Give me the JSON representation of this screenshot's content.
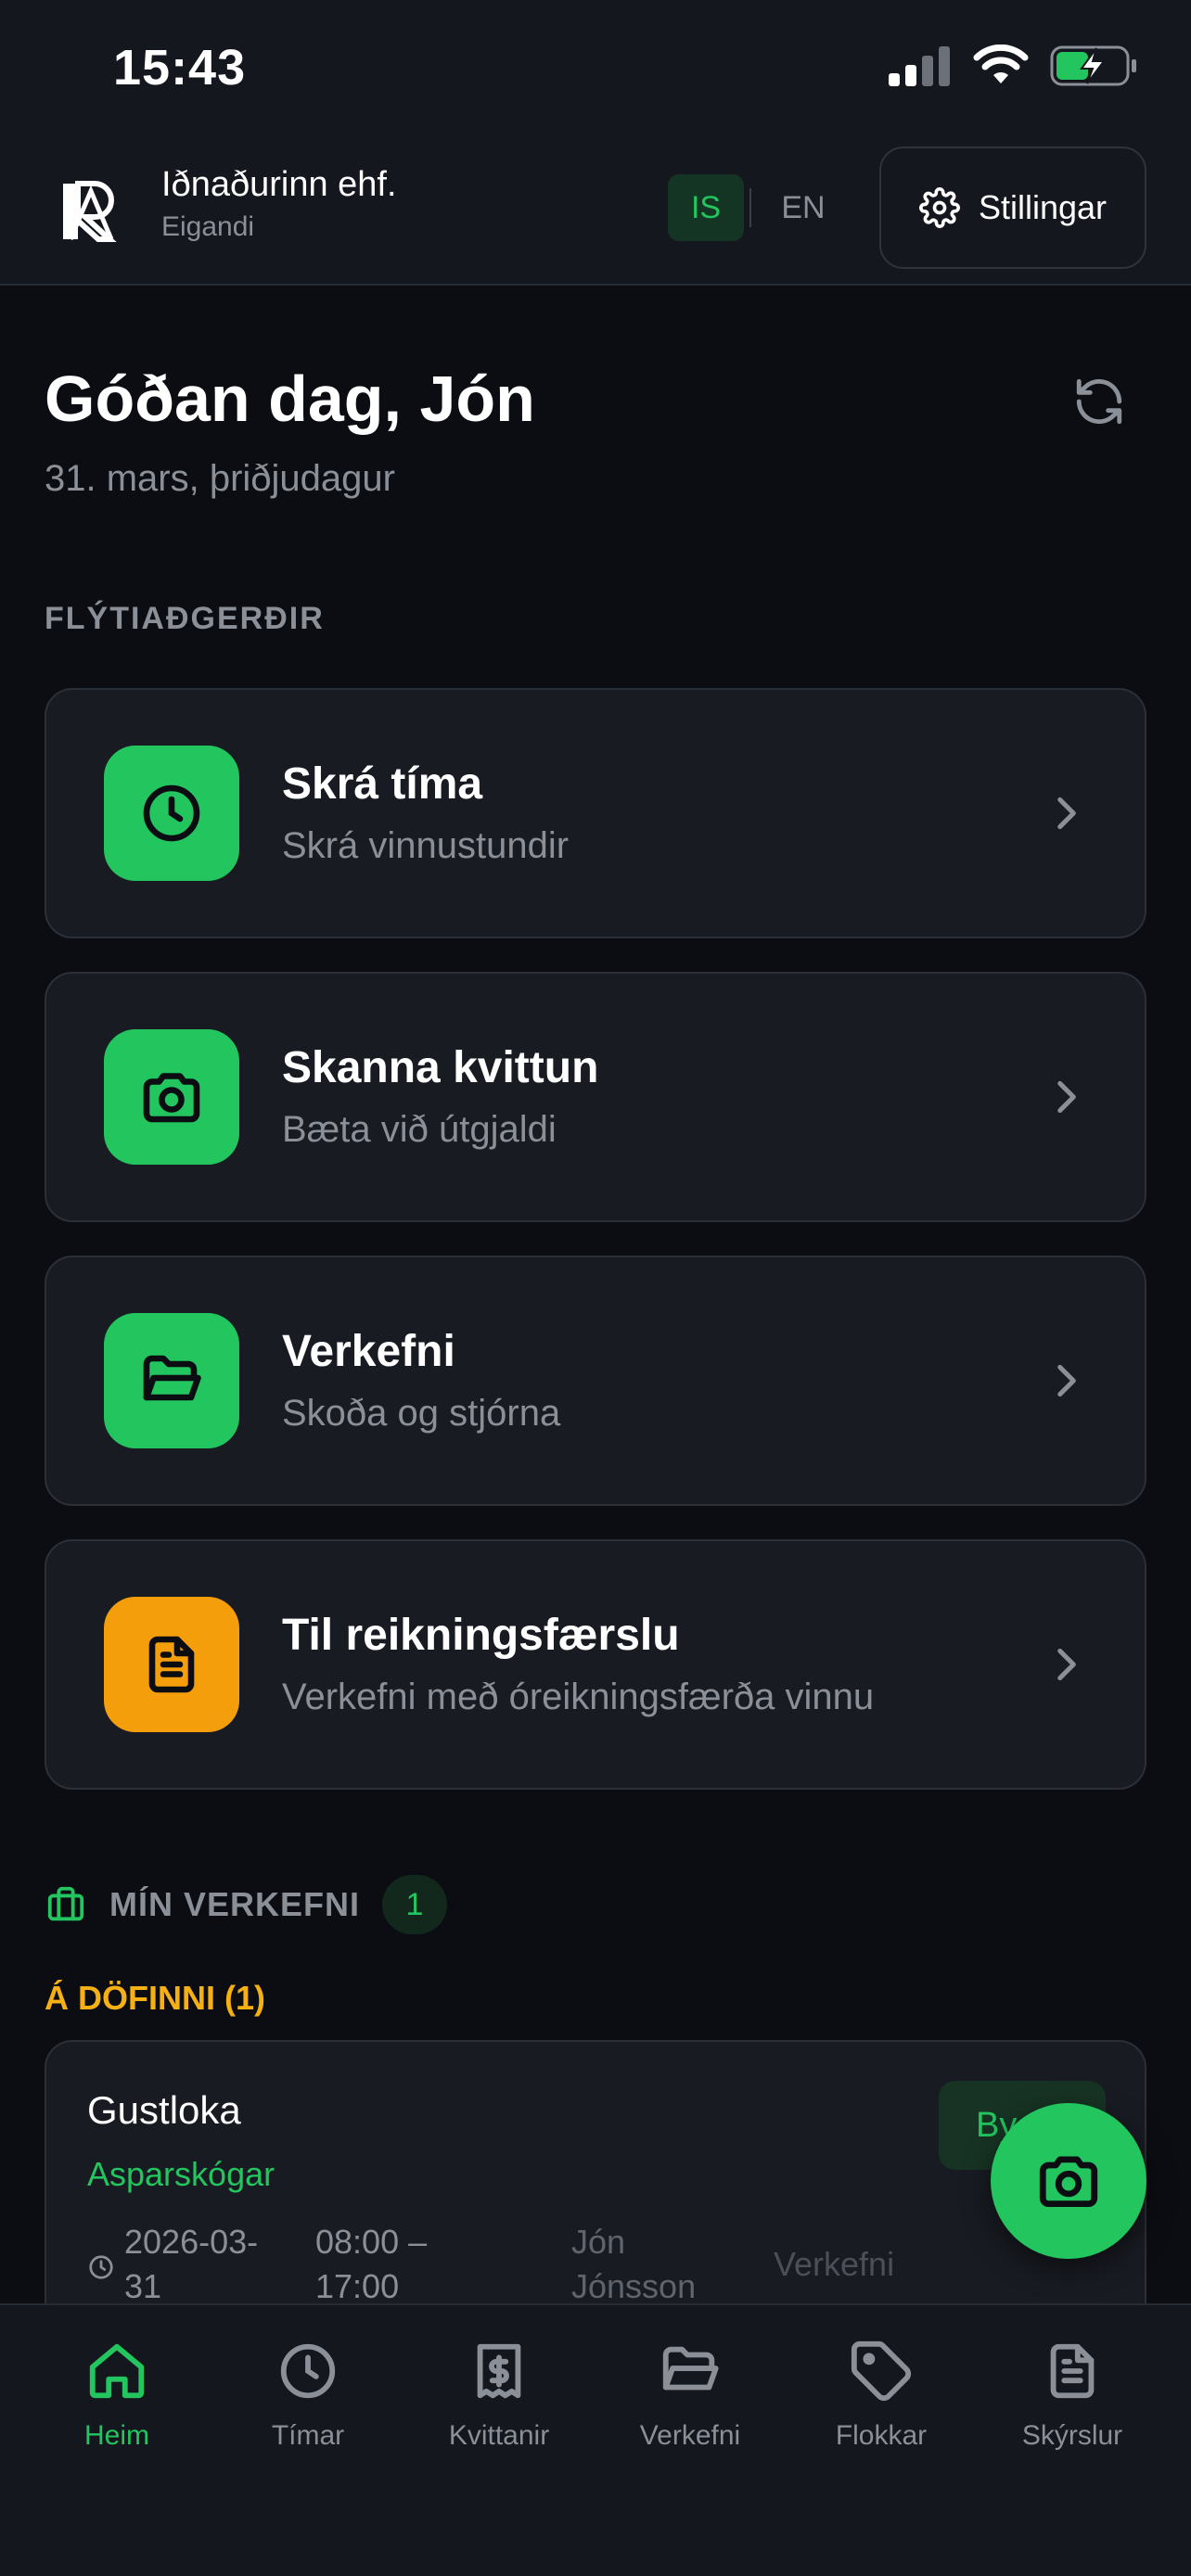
{
  "status_bar": {
    "time": "15:43"
  },
  "header": {
    "company_name": "Iðnaðurinn ehf.",
    "role": "Eigandi",
    "lang_is": "IS",
    "lang_en": "EN",
    "settings_label": "Stillingar"
  },
  "greeting": {
    "title": "Góðan dag, Jón",
    "date": "31. mars, þriðjudagur"
  },
  "quick_actions": {
    "label": "FLÝTIAÐGERÐIR",
    "items": [
      {
        "title": "Skrá tíma",
        "subtitle": "Skrá vinnustundir",
        "icon": "clock-icon",
        "color": "#22c55e"
      },
      {
        "title": "Skanna kvittun",
        "subtitle": "Bæta við útgjaldi",
        "icon": "camera-icon",
        "color": "#22c55e"
      },
      {
        "title": "Verkefni",
        "subtitle": "Skoða og stjórna",
        "icon": "folder-icon",
        "color": "#22c55e"
      },
      {
        "title": "Til reikningsfærslu",
        "subtitle": "Verkefni með óreikningsfærða vinnu",
        "icon": "document-icon",
        "color": "#f59e0b"
      }
    ]
  },
  "my_projects": {
    "label": "MÍN VERKEFNI",
    "count": "1",
    "pending_label": "Á DÖFINNI (1)",
    "task": {
      "title": "Gustloka",
      "subtitle": "Asparskógar",
      "status": "By",
      "date_line1": "2026-03-",
      "date_line2": "31",
      "time_line1": "08:00 –",
      "time_line2": "17:00",
      "person_line1": "Jón",
      "person_line2": "Jónsson",
      "type": "Verkefni"
    }
  },
  "tab_bar": {
    "items": [
      {
        "label": "Heim",
        "icon": "home-icon",
        "active": true
      },
      {
        "label": "Tímar",
        "icon": "clock-icon",
        "active": false
      },
      {
        "label": "Kvittanir",
        "icon": "receipt-icon",
        "active": false
      },
      {
        "label": "Verkefni",
        "icon": "folder-icon",
        "active": false
      },
      {
        "label": "Flokkar",
        "icon": "tag-icon",
        "active": false
      },
      {
        "label": "Skýrslur",
        "icon": "report-icon",
        "active": false
      }
    ]
  },
  "colors": {
    "accent": "#22c55e",
    "warning": "#f59e0b",
    "background": "#0b0d12",
    "surface": "#181b22"
  }
}
